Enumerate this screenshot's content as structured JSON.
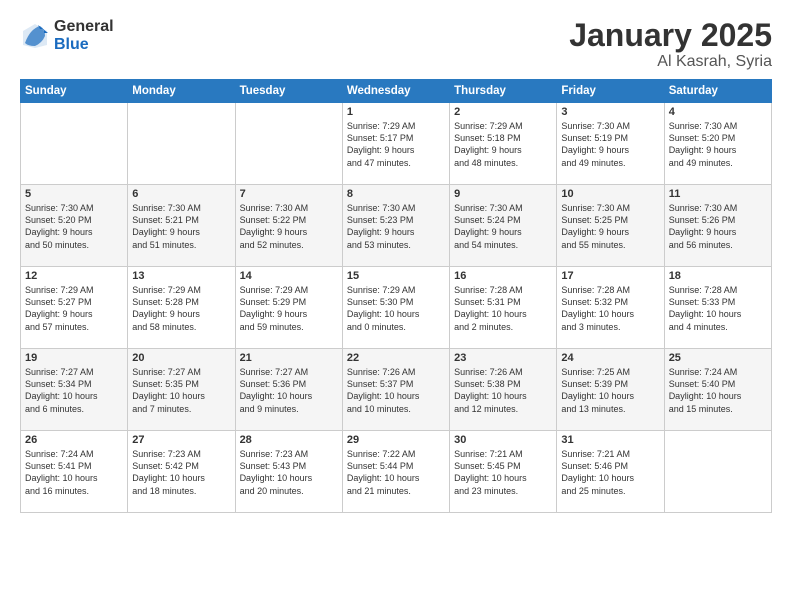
{
  "logo": {
    "general": "General",
    "blue": "Blue"
  },
  "header": {
    "title": "January 2025",
    "subtitle": "Al Kasrah, Syria"
  },
  "weekdays": [
    "Sunday",
    "Monday",
    "Tuesday",
    "Wednesday",
    "Thursday",
    "Friday",
    "Saturday"
  ],
  "weeks": [
    [
      {
        "day": "",
        "info": ""
      },
      {
        "day": "",
        "info": ""
      },
      {
        "day": "",
        "info": ""
      },
      {
        "day": "1",
        "info": "Sunrise: 7:29 AM\nSunset: 5:17 PM\nDaylight: 9 hours\nand 47 minutes."
      },
      {
        "day": "2",
        "info": "Sunrise: 7:29 AM\nSunset: 5:18 PM\nDaylight: 9 hours\nand 48 minutes."
      },
      {
        "day": "3",
        "info": "Sunrise: 7:30 AM\nSunset: 5:19 PM\nDaylight: 9 hours\nand 49 minutes."
      },
      {
        "day": "4",
        "info": "Sunrise: 7:30 AM\nSunset: 5:20 PM\nDaylight: 9 hours\nand 49 minutes."
      }
    ],
    [
      {
        "day": "5",
        "info": "Sunrise: 7:30 AM\nSunset: 5:20 PM\nDaylight: 9 hours\nand 50 minutes."
      },
      {
        "day": "6",
        "info": "Sunrise: 7:30 AM\nSunset: 5:21 PM\nDaylight: 9 hours\nand 51 minutes."
      },
      {
        "day": "7",
        "info": "Sunrise: 7:30 AM\nSunset: 5:22 PM\nDaylight: 9 hours\nand 52 minutes."
      },
      {
        "day": "8",
        "info": "Sunrise: 7:30 AM\nSunset: 5:23 PM\nDaylight: 9 hours\nand 53 minutes."
      },
      {
        "day": "9",
        "info": "Sunrise: 7:30 AM\nSunset: 5:24 PM\nDaylight: 9 hours\nand 54 minutes."
      },
      {
        "day": "10",
        "info": "Sunrise: 7:30 AM\nSunset: 5:25 PM\nDaylight: 9 hours\nand 55 minutes."
      },
      {
        "day": "11",
        "info": "Sunrise: 7:30 AM\nSunset: 5:26 PM\nDaylight: 9 hours\nand 56 minutes."
      }
    ],
    [
      {
        "day": "12",
        "info": "Sunrise: 7:29 AM\nSunset: 5:27 PM\nDaylight: 9 hours\nand 57 minutes."
      },
      {
        "day": "13",
        "info": "Sunrise: 7:29 AM\nSunset: 5:28 PM\nDaylight: 9 hours\nand 58 minutes."
      },
      {
        "day": "14",
        "info": "Sunrise: 7:29 AM\nSunset: 5:29 PM\nDaylight: 9 hours\nand 59 minutes."
      },
      {
        "day": "15",
        "info": "Sunrise: 7:29 AM\nSunset: 5:30 PM\nDaylight: 10 hours\nand 0 minutes."
      },
      {
        "day": "16",
        "info": "Sunrise: 7:28 AM\nSunset: 5:31 PM\nDaylight: 10 hours\nand 2 minutes."
      },
      {
        "day": "17",
        "info": "Sunrise: 7:28 AM\nSunset: 5:32 PM\nDaylight: 10 hours\nand 3 minutes."
      },
      {
        "day": "18",
        "info": "Sunrise: 7:28 AM\nSunset: 5:33 PM\nDaylight: 10 hours\nand 4 minutes."
      }
    ],
    [
      {
        "day": "19",
        "info": "Sunrise: 7:27 AM\nSunset: 5:34 PM\nDaylight: 10 hours\nand 6 minutes."
      },
      {
        "day": "20",
        "info": "Sunrise: 7:27 AM\nSunset: 5:35 PM\nDaylight: 10 hours\nand 7 minutes."
      },
      {
        "day": "21",
        "info": "Sunrise: 7:27 AM\nSunset: 5:36 PM\nDaylight: 10 hours\nand 9 minutes."
      },
      {
        "day": "22",
        "info": "Sunrise: 7:26 AM\nSunset: 5:37 PM\nDaylight: 10 hours\nand 10 minutes."
      },
      {
        "day": "23",
        "info": "Sunrise: 7:26 AM\nSunset: 5:38 PM\nDaylight: 10 hours\nand 12 minutes."
      },
      {
        "day": "24",
        "info": "Sunrise: 7:25 AM\nSunset: 5:39 PM\nDaylight: 10 hours\nand 13 minutes."
      },
      {
        "day": "25",
        "info": "Sunrise: 7:24 AM\nSunset: 5:40 PM\nDaylight: 10 hours\nand 15 minutes."
      }
    ],
    [
      {
        "day": "26",
        "info": "Sunrise: 7:24 AM\nSunset: 5:41 PM\nDaylight: 10 hours\nand 16 minutes."
      },
      {
        "day": "27",
        "info": "Sunrise: 7:23 AM\nSunset: 5:42 PM\nDaylight: 10 hours\nand 18 minutes."
      },
      {
        "day": "28",
        "info": "Sunrise: 7:23 AM\nSunset: 5:43 PM\nDaylight: 10 hours\nand 20 minutes."
      },
      {
        "day": "29",
        "info": "Sunrise: 7:22 AM\nSunset: 5:44 PM\nDaylight: 10 hours\nand 21 minutes."
      },
      {
        "day": "30",
        "info": "Sunrise: 7:21 AM\nSunset: 5:45 PM\nDaylight: 10 hours\nand 23 minutes."
      },
      {
        "day": "31",
        "info": "Sunrise: 7:21 AM\nSunset: 5:46 PM\nDaylight: 10 hours\nand 25 minutes."
      },
      {
        "day": "",
        "info": ""
      }
    ]
  ]
}
